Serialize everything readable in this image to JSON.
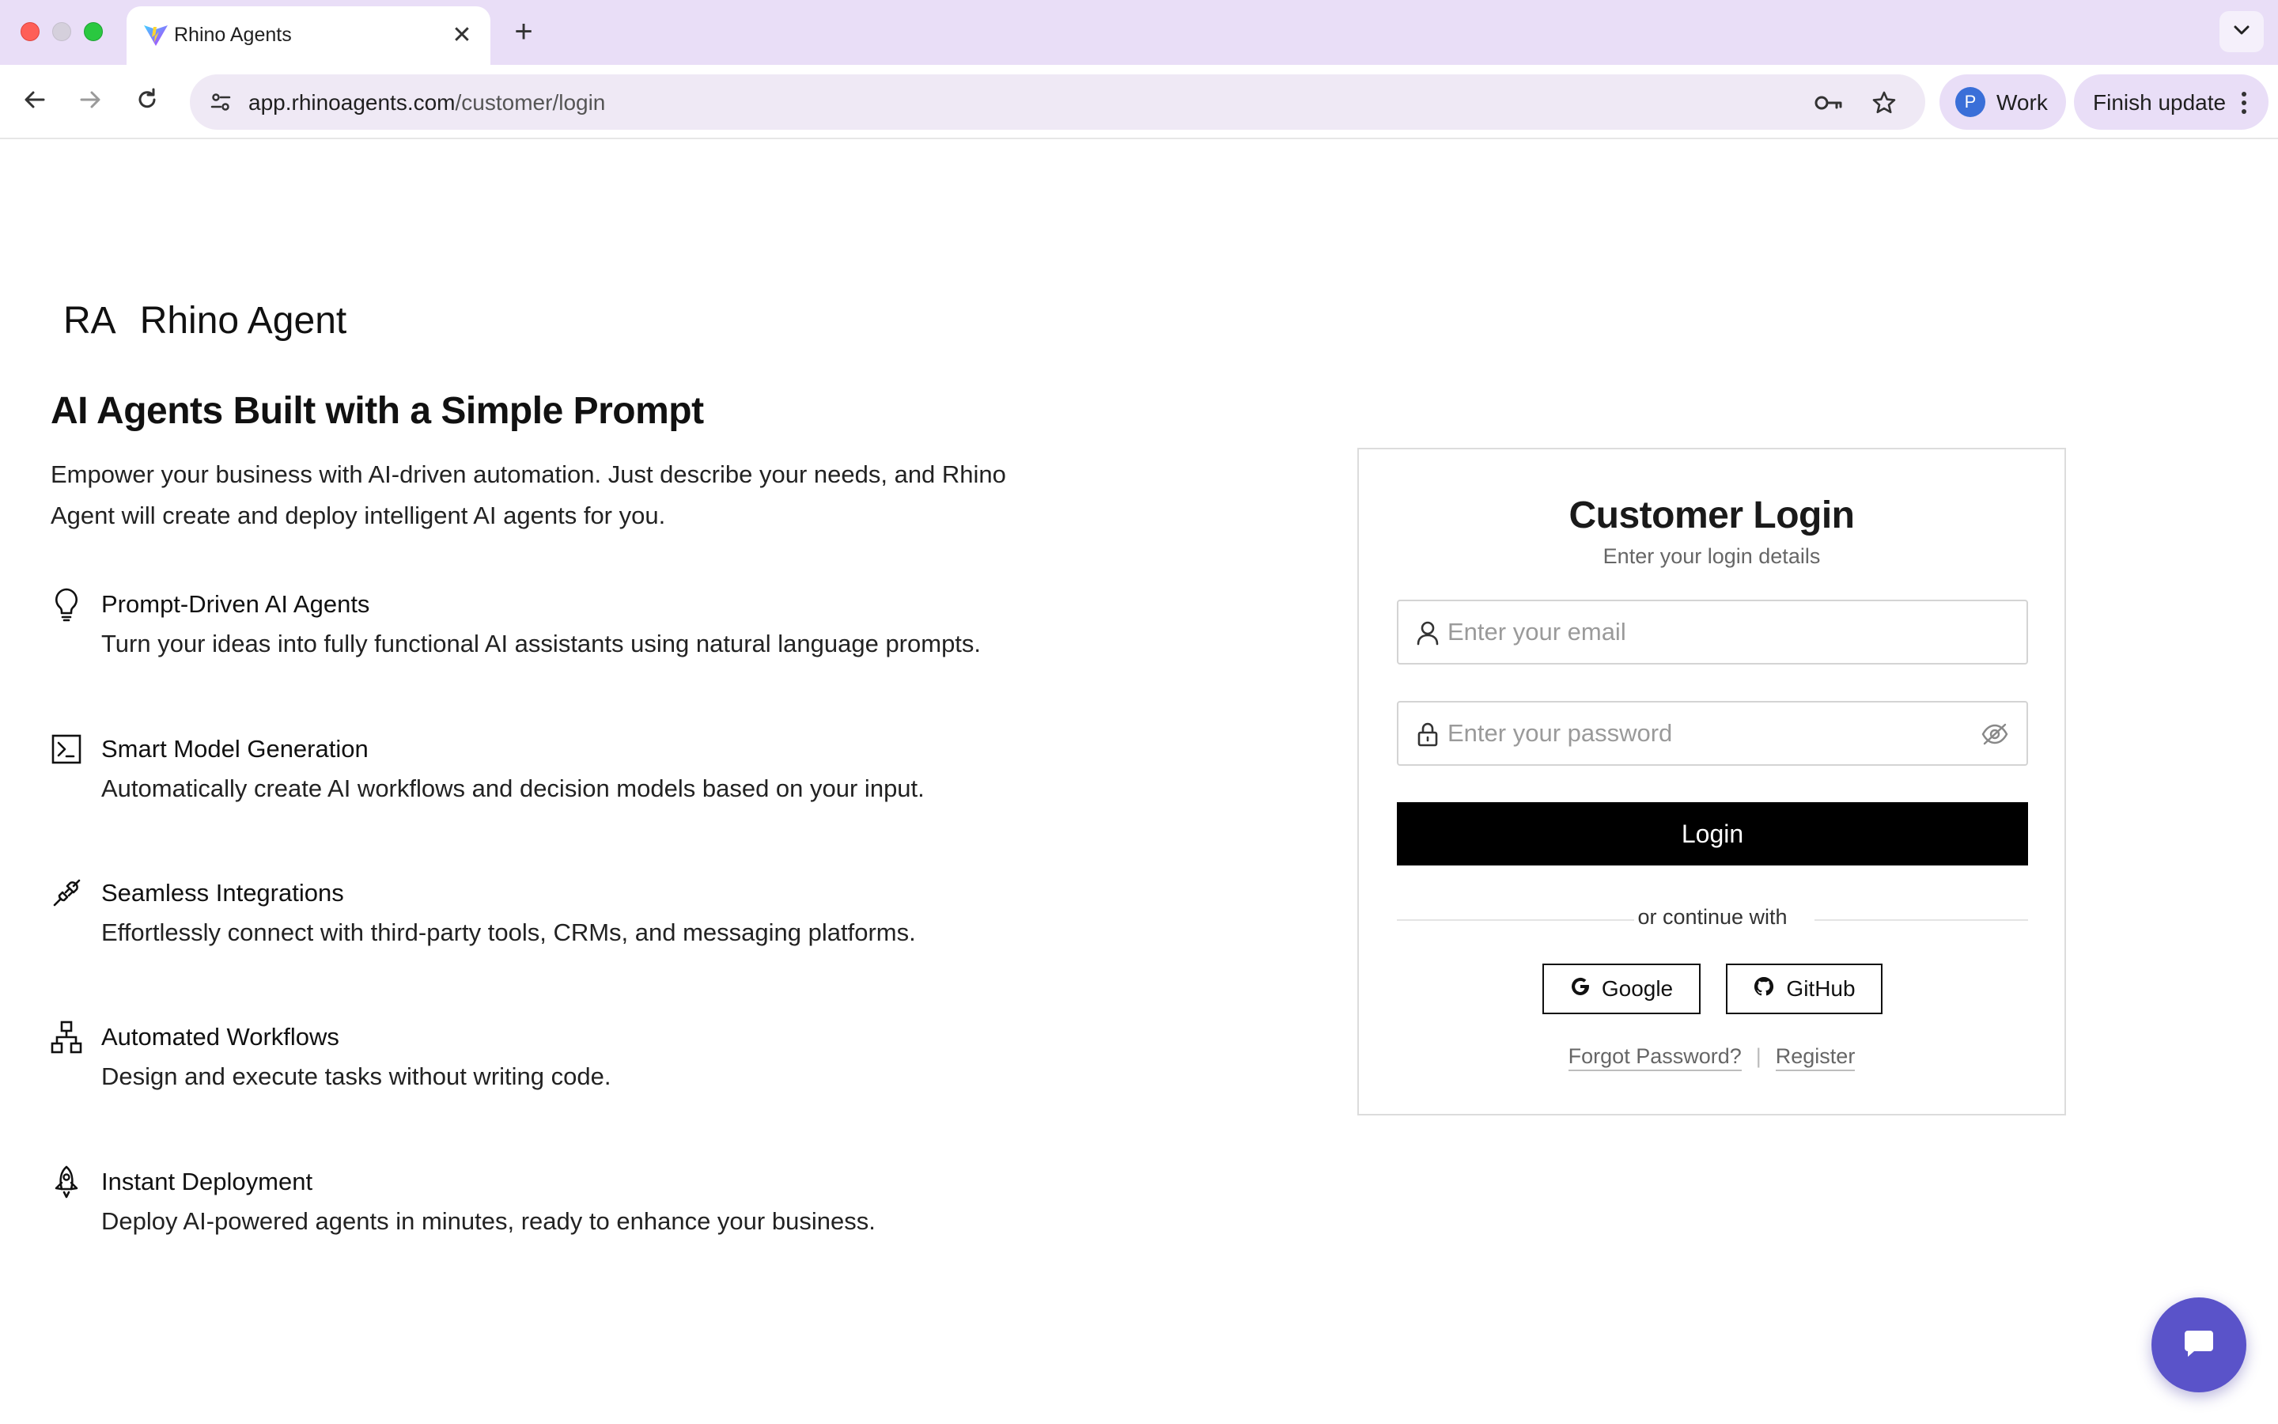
{
  "browser": {
    "tab_title": "Rhino Agents",
    "tab_close": "✕",
    "new_tab": "+",
    "url_host": "app.rhinoagents.com",
    "url_path": "/customer/login",
    "profile_initial": "P",
    "profile_label": "Work",
    "finish_update": "Finish update"
  },
  "brand": {
    "mark": "RA",
    "name": "Rhino Agent"
  },
  "hero": {
    "headline": "AI Agents Built with a Simple Prompt",
    "intro": "Empower your business with AI-driven automation. Just describe your needs, and Rhino Agent will create and deploy intelligent AI agents for you."
  },
  "features": [
    {
      "icon": "lightbulb-icon",
      "title": "Prompt-Driven AI Agents",
      "description": "Turn your ideas into fully functional AI assistants using natural language prompts."
    },
    {
      "icon": "terminal-icon",
      "title": "Smart Model Generation",
      "description": "Automatically create AI workflows and decision models based on your input."
    },
    {
      "icon": "plug-icon",
      "title": "Seamless Integrations",
      "description": "Effortlessly connect with third-party tools, CRMs, and messaging platforms."
    },
    {
      "icon": "network-icon",
      "title": "Automated Workflows",
      "description": "Design and execute tasks without writing code."
    },
    {
      "icon": "rocket-icon",
      "title": "Instant Deployment",
      "description": "Deploy AI-powered agents in minutes, ready to enhance your business."
    }
  ],
  "login": {
    "title": "Customer Login",
    "subtitle": "Enter your login details",
    "email_placeholder": "Enter your email",
    "password_placeholder": "Enter your password",
    "submit_label": "Login",
    "divider_text": "or continue with",
    "google_label": "Google",
    "github_label": "GitHub",
    "forgot_label": "Forgot Password?",
    "separator": "|",
    "register_label": "Register"
  },
  "colors": {
    "accent": "#000000",
    "chat_button": "#5a53c9",
    "chrome_bg": "#e9def7"
  }
}
